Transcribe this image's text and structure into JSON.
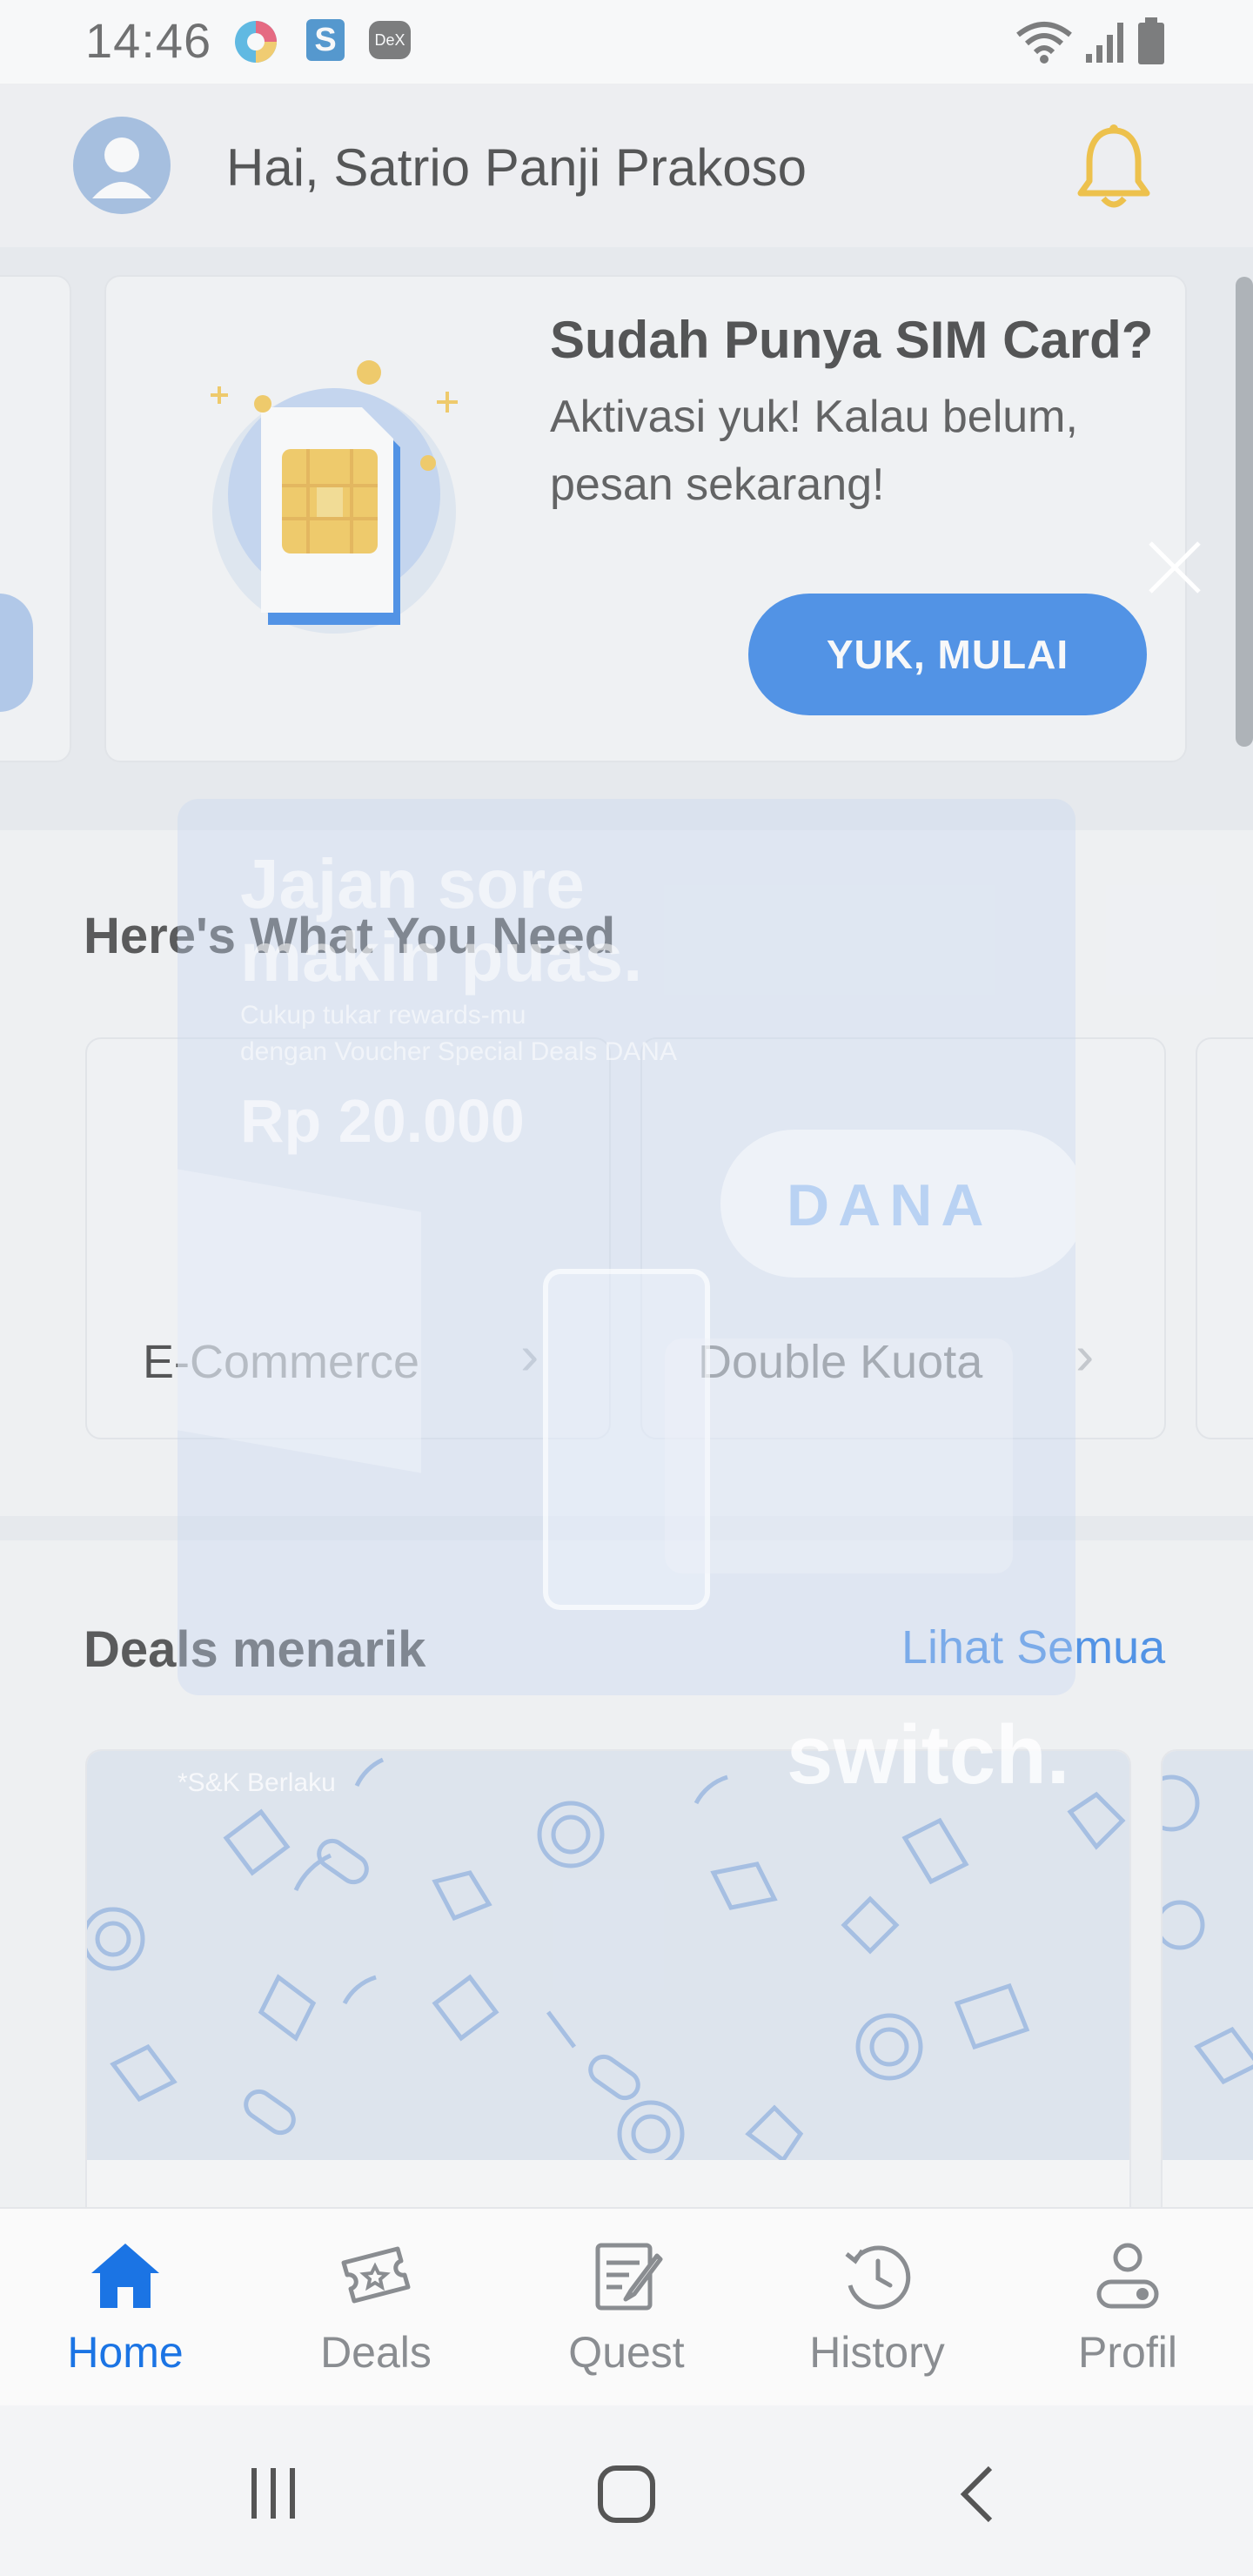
{
  "status_bar": {
    "time": "14:46",
    "apps": [
      "circle-app-icon",
      "s-app-icon",
      "dex-app-icon"
    ],
    "dex_label": "DeX",
    "s_label": "S",
    "icons": [
      "wifi-icon",
      "signal-icon",
      "battery-icon"
    ]
  },
  "header": {
    "greeting": "Hai, Satrio Panji Prakoso",
    "avatar_icon": "user-avatar-icon",
    "notification_icon": "bell-icon"
  },
  "banner": {
    "title": "Sudah Punya SIM Card?",
    "subtitle": "Aktivasi yuk! Kalau belum, pesan sekarang!",
    "button": "YUK, MULAI",
    "illustration": "sim-card-icon"
  },
  "needs": {
    "title": "Here's What You Need",
    "items": [
      {
        "label": "E-Commerce"
      },
      {
        "label": "Double Kuota"
      }
    ]
  },
  "deals": {
    "title": "Deals menarik",
    "see_all": "Lihat Semua"
  },
  "popup": {
    "headline": "Jajan sore makin puas.",
    "line1": "Cukup tukar rewards-mu",
    "line2": "dengan Voucher Special Deals DANA",
    "amount": "Rp 20.000",
    "brand": "DANA",
    "terms": "*S&K Berlaku",
    "wordmark": "switch."
  },
  "bottom_nav": [
    {
      "label": "Home",
      "icon": "home-icon",
      "active": true
    },
    {
      "label": "Deals",
      "icon": "ticket-icon",
      "active": false
    },
    {
      "label": "Quest",
      "icon": "quest-icon",
      "active": false
    },
    {
      "label": "History",
      "icon": "history-icon",
      "active": false
    },
    {
      "label": "Profil",
      "icon": "profile-icon",
      "active": false
    }
  ],
  "colors": {
    "accent": "#1b74e4",
    "bell": "#f2b311",
    "inactive": "#8a8d91"
  }
}
